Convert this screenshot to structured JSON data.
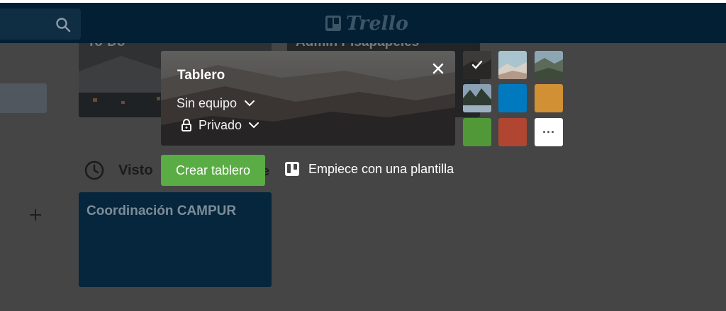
{
  "header": {
    "logo_text": "Trello"
  },
  "background": {
    "boards": [
      {
        "title": "To-Do"
      },
      {
        "title": "Admin Pisapapeles"
      }
    ],
    "recent_label": "Visto",
    "recent_tail": "e",
    "recent_board_title": "Coordinación CAMPUR"
  },
  "create_board": {
    "title_value": "Tablero",
    "team_label": "Sin equipo",
    "visibility_label": "Privado",
    "create_button_label": "Crear tablero",
    "template_link_label": "Empiece con una plantilla",
    "background_options": [
      {
        "type": "photo",
        "subject": "dark mountain landscape",
        "selected": true
      },
      {
        "type": "photo",
        "subject": "snowy hills",
        "selected": false
      },
      {
        "type": "photo",
        "subject": "mountain valley",
        "selected": false
      },
      {
        "type": "photo",
        "subject": "coastal trees",
        "selected": false
      },
      {
        "type": "color",
        "color": "#0079bf",
        "selected": false
      },
      {
        "type": "color",
        "color": "#d29034",
        "selected": false
      },
      {
        "type": "color",
        "color": "#519839",
        "selected": false
      },
      {
        "type": "color",
        "color": "#b04632",
        "selected": false
      }
    ],
    "more_label": "···"
  },
  "colors": {
    "header": "#021f33",
    "overlay": "#454545",
    "create_button": "#5aac44",
    "recent_board": "#05263c"
  }
}
